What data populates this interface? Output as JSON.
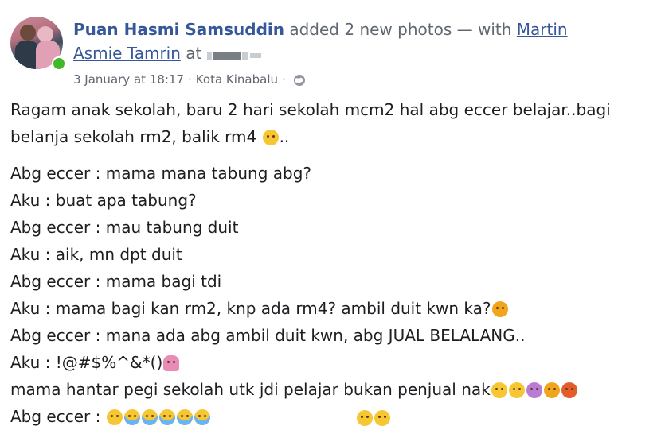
{
  "post": {
    "author": "Puan Hasmi Samsuddin",
    "action": "added 2 new photos — with",
    "tagged_first": "Martin",
    "tagged_second": "Asmie Tamrin",
    "at_word": "at",
    "date": "3 January at 18:17",
    "separator": "·",
    "place": "Kota Kinabalu",
    "intro_line1": "Ragam anak sekolah, baru 2 hari sekolah mcm2 hal abg eccer belajar..bagi",
    "intro_line2": "belanja sekolah rm2, balik rm4",
    "intro_line2_tail": "..",
    "lines": [
      "Abg eccer : mama mana tabung abg?",
      "Aku : buat apa tabung?",
      "Abg eccer : mau tabung duit",
      "Aku : aik, mn dpt duit",
      "Abg eccer : mama bagi tdi",
      "Aku : mama bagi kan rm2, knp ada rm4? ambil duit kwn ka?",
      "Abg eccer : mana ada abg ambil duit kwn, abg JUAL BELALANG..",
      "Aku : !@#$%^&*()",
      "mama hantar pegi sekolah utk jdi pelajar bukan penjual nak",
      "Abg eccer : "
    ]
  },
  "icons": {
    "avatar": "avatar-photo",
    "online": "online-status-dot",
    "privacy": "globe-icon",
    "emojis": [
      "thinking-face",
      "angry-face",
      "woman-facepalming",
      "sleepy-face",
      "unamused-face",
      "dizzy-face",
      "angry-face",
      "swearing-face",
      "crying-faces"
    ]
  },
  "colors": {
    "link": "#365899",
    "meta": "#616770",
    "text": "#1c1e21",
    "online": "#42b72a"
  }
}
